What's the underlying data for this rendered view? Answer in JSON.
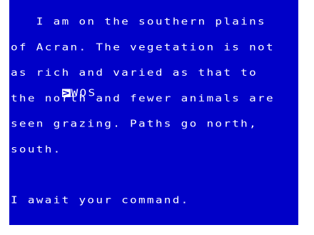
{
  "screen": {
    "background_color": "#0000c8",
    "text_color": "#ffffff",
    "description_lines": [
      "   I am on the southern plains",
      "of Acran. The vegetation is not",
      "as rich and varied as that to",
      "the north and fewer animals are",
      "seen grazing. Paths go north,",
      "south."
    ],
    "status_line": "I await your command.",
    "prompt": {
      "cursor_glyph": ">",
      "input_value": "WOS"
    }
  }
}
